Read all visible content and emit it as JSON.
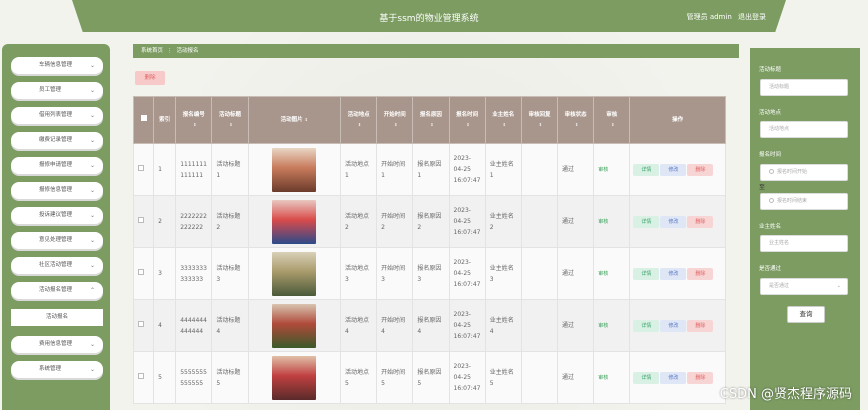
{
  "header": {
    "title": "基于ssm的物业管理系统",
    "role_user": "管理员 admin",
    "logout": "退出登录"
  },
  "sidebar": {
    "items": [
      {
        "label": "车辆信息管理",
        "chevron": "⌄"
      },
      {
        "label": "员工管理",
        "chevron": "⌄"
      },
      {
        "label": "借用列表管理",
        "chevron": "⌄"
      },
      {
        "label": "缴费记录管理",
        "chevron": "⌄"
      },
      {
        "label": "报修申请管理",
        "chevron": "⌄"
      },
      {
        "label": "报修信息管理",
        "chevron": "⌄"
      },
      {
        "label": "投诉建议管理",
        "chevron": "⌄"
      },
      {
        "label": "意见处理管理",
        "chevron": "⌄"
      },
      {
        "label": "社区活动管理",
        "chevron": "⌄"
      },
      {
        "label": "活动报名管理",
        "chevron": "⌃"
      },
      {
        "label": "活动报名",
        "chevron": ""
      },
      {
        "label": "费用信息管理",
        "chevron": "⌄"
      },
      {
        "label": "系统管理",
        "chevron": "⌄"
      }
    ]
  },
  "breadcrumb": {
    "home": "系统首页",
    "sep": "⋮",
    "current": "活动报名"
  },
  "toolbar": {
    "delete_label": "删除"
  },
  "table": {
    "headers": [
      "索引",
      "报名编号",
      "活动标题",
      "活动图片",
      "活动地点",
      "开始时间",
      "报名原因",
      "报名时间",
      "业主姓名",
      "审核回复",
      "审核状态",
      "审核",
      "操作"
    ],
    "sort_mark": "⇕",
    "rows": [
      {
        "index": "1",
        "number": "1111111111111",
        "title": "活动标题1",
        "place": "活动地点1",
        "start": "开始时间1",
        "reason": "报名原因1",
        "time": "2023-04-25 16:07:47",
        "owner": "业主姓名1",
        "reply": "",
        "status": "通过",
        "review": "审核"
      },
      {
        "index": "2",
        "number": "2222222222222",
        "title": "活动标题2",
        "place": "活动地点2",
        "start": "开始时间2",
        "reason": "报名原因2",
        "time": "2023-04-25 16:07:47",
        "owner": "业主姓名2",
        "reply": "",
        "status": "通过",
        "review": "审核"
      },
      {
        "index": "3",
        "number": "3333333333333",
        "title": "活动标题3",
        "place": "活动地点3",
        "start": "开始时间3",
        "reason": "报名原因3",
        "time": "2023-04-25 16:07:47",
        "owner": "业主姓名3",
        "reply": "",
        "status": "通过",
        "review": "审核"
      },
      {
        "index": "4",
        "number": "4444444444444",
        "title": "活动标题4",
        "place": "活动地点4",
        "start": "开始时间4",
        "reason": "报名原因4",
        "time": "2023-04-25 16:07:47",
        "owner": "业主姓名4",
        "reply": "",
        "status": "通过",
        "review": "审核"
      },
      {
        "index": "5",
        "number": "5555555555555",
        "title": "活动标题5",
        "place": "活动地点5",
        "start": "开始时间5",
        "reason": "报名原因5",
        "time": "2023-04-25 16:07:47",
        "owner": "业主姓名5",
        "reply": "",
        "status": "通过",
        "review": "审核"
      }
    ],
    "actions": {
      "detail": "详情",
      "edit": "修改",
      "delete": "删除"
    }
  },
  "search": {
    "title_label": "活动标题",
    "title_placeholder": "活动标题",
    "place_label": "活动地点",
    "place_placeholder": "活动地点",
    "time_label": "报名时间",
    "time_start_placeholder": "报名时间开始",
    "time_to": "至",
    "time_end_placeholder": "报名时间结束",
    "owner_label": "业主姓名",
    "owner_placeholder": "业主姓名",
    "pass_label": "是否通过",
    "pass_placeholder": "是否通过",
    "query_button": "查询"
  },
  "watermark": "CSDN @贤杰程序源码",
  "colors": {
    "primary": "#7c9c62",
    "table_header": "#a8968c"
  }
}
